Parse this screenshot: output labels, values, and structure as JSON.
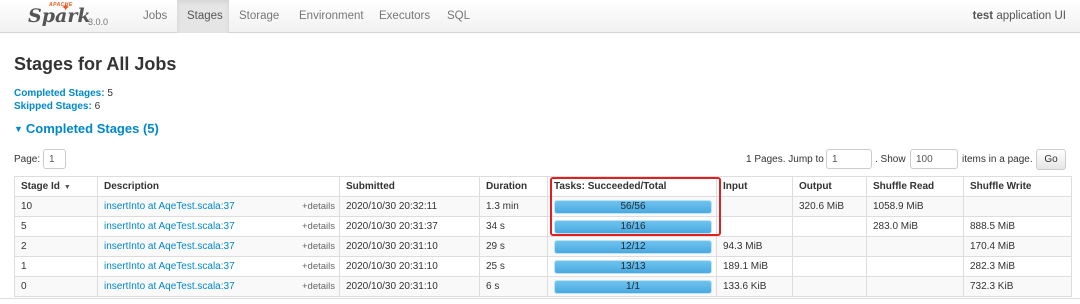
{
  "navbar": {
    "logo_apache": "APACHE",
    "logo_word": "Spark",
    "version": "3.0.0",
    "tabs": [
      {
        "label": "Jobs",
        "active": false
      },
      {
        "label": "Stages",
        "active": true
      },
      {
        "label": "Storage",
        "active": false
      },
      {
        "label": "Environment",
        "active": false
      },
      {
        "label": "Executors",
        "active": false
      },
      {
        "label": "SQL",
        "active": false
      }
    ],
    "app_name_bold": "test",
    "app_name_suffix": " application UI"
  },
  "page": {
    "title": "Stages for All Jobs",
    "summary": [
      {
        "label": "Completed Stages:",
        "value": "5"
      },
      {
        "label": "Skipped Stages:",
        "value": "6"
      }
    ],
    "section_title": "Completed Stages (5)"
  },
  "pager": {
    "page_label": "Page:",
    "page_value": "1",
    "jump_text": "1 Pages. Jump to",
    "jump_value": "1",
    "show_label": ". Show",
    "show_value": "100",
    "items_text": "items in a page.",
    "go_label": "Go"
  },
  "table": {
    "columns": [
      "Stage Id",
      "Description",
      "Submitted",
      "Duration",
      "Tasks: Succeeded/Total",
      "Input",
      "Output",
      "Shuffle Read",
      "Shuffle Write"
    ],
    "sort_indicator": "▼",
    "details_label": "+details",
    "rows": [
      {
        "stage_id": "10",
        "description": "insertInto at AqeTest.scala:37",
        "submitted": "2020/10/30 20:32:11",
        "duration": "1.3 min",
        "tasks": "56/56",
        "progress": 1.0,
        "input": "",
        "output": "320.6 MiB",
        "shuffle_read": "1058.9 MiB",
        "shuffle_write": ""
      },
      {
        "stage_id": "5",
        "description": "insertInto at AqeTest.scala:37",
        "submitted": "2020/10/30 20:31:37",
        "duration": "34 s",
        "tasks": "16/16",
        "progress": 1.0,
        "input": "",
        "output": "",
        "shuffle_read": "283.0 MiB",
        "shuffle_write": "888.5 MiB"
      },
      {
        "stage_id": "2",
        "description": "insertInto at AqeTest.scala:37",
        "submitted": "2020/10/30 20:31:10",
        "duration": "29 s",
        "tasks": "12/12",
        "progress": 1.0,
        "input": "94.3 MiB",
        "output": "",
        "shuffle_read": "",
        "shuffle_write": "170.4 MiB"
      },
      {
        "stage_id": "1",
        "description": "insertInto at AqeTest.scala:37",
        "submitted": "2020/10/30 20:31:10",
        "duration": "25 s",
        "tasks": "13/13",
        "progress": 1.0,
        "input": "189.1 MiB",
        "output": "",
        "shuffle_read": "",
        "shuffle_write": "282.3 MiB"
      },
      {
        "stage_id": "0",
        "description": "insertInto at AqeTest.scala:37",
        "submitted": "2020/10/30 20:31:10",
        "duration": "6 s",
        "tasks": "1/1",
        "progress": 1.0,
        "input": "133.6 KiB",
        "output": "",
        "shuffle_read": "",
        "shuffle_write": "732.3 KiB"
      }
    ]
  },
  "colors": {
    "link": "#0088cc",
    "spark_orange": "#e25a1c",
    "progress_fill": "#4aa8e0",
    "highlight": "#e02020"
  }
}
